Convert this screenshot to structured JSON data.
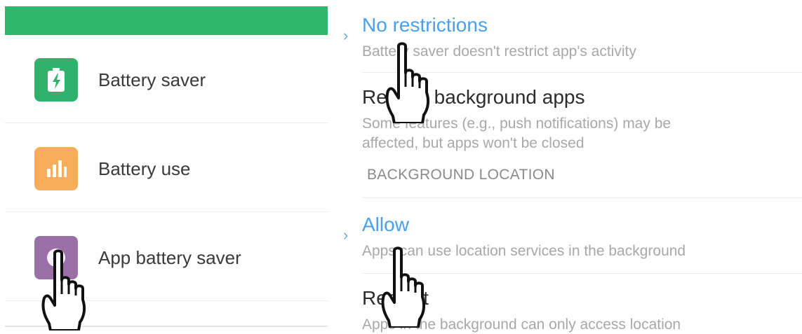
{
  "left": {
    "items": [
      {
        "label": "Battery saver",
        "icon": "battery-bolt-icon",
        "color": "#2fb26b"
      },
      {
        "label": "Battery use",
        "icon": "bar-chart-icon",
        "color": "#f7ad5a"
      },
      {
        "label": "App battery saver",
        "icon": "app-battery-icon",
        "color": "#9b6fa8"
      }
    ]
  },
  "right": {
    "options": [
      {
        "title": "No restrictions",
        "desc": "Battery saver doesn't restrict app's activity",
        "selected": true
      },
      {
        "title": "Restrict background apps",
        "desc_lines": [
          "Some features (e.g., push notifications) may be",
          "affected, but apps won't be closed"
        ],
        "selected": false
      }
    ],
    "section_header": "BACKGROUND LOCATION",
    "location_options": [
      {
        "title": "Allow",
        "desc": "Apps can use location services in the background",
        "selected": true
      },
      {
        "title": "Restrict",
        "desc": "Apps in the background can only access location",
        "selected": false
      }
    ]
  },
  "colors": {
    "header_green": "#30b66d",
    "selected_blue": "#48a0f0"
  }
}
